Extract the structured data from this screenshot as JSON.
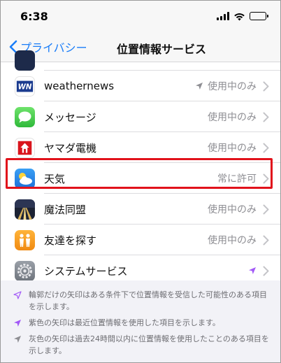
{
  "status_bar": {
    "time": "6:38"
  },
  "nav": {
    "back_label": "プライバシー",
    "title": "位置情報サービス"
  },
  "rows": [
    {
      "label": "weathernews",
      "value": "使用中のみ",
      "arrow": "gray"
    },
    {
      "label": "メッセージ",
      "value": "使用中のみ"
    },
    {
      "label": "ヤマダ電機",
      "value": "使用中のみ"
    },
    {
      "label": "天気",
      "value": "常に許可"
    },
    {
      "label": "魔法同盟",
      "value": "使用中のみ"
    },
    {
      "label": "友達を探す",
      "value": "使用中のみ"
    },
    {
      "label": "システムサービス",
      "value": "",
      "arrow": "purple"
    }
  ],
  "notes": [
    {
      "text": "輪郭だけの矢印はある条件下で位置情報を受信した可能性のある項目を示します。",
      "arrow": "outline-purple"
    },
    {
      "text": "紫色の矢印は最近位置情報を使用した項目を示します。",
      "arrow": "purple"
    },
    {
      "text": "灰色の矢印は過去24時間以内に位置情報を使用したことのある項目を示します。",
      "arrow": "gray"
    }
  ],
  "colors": {
    "accent": "#1a7df8",
    "highlight": "#e1121b",
    "purple_arrow": "#a259f7",
    "gray_arrow": "#8e8e93"
  },
  "app_texts": {
    "weathernews_logo": "WN"
  }
}
